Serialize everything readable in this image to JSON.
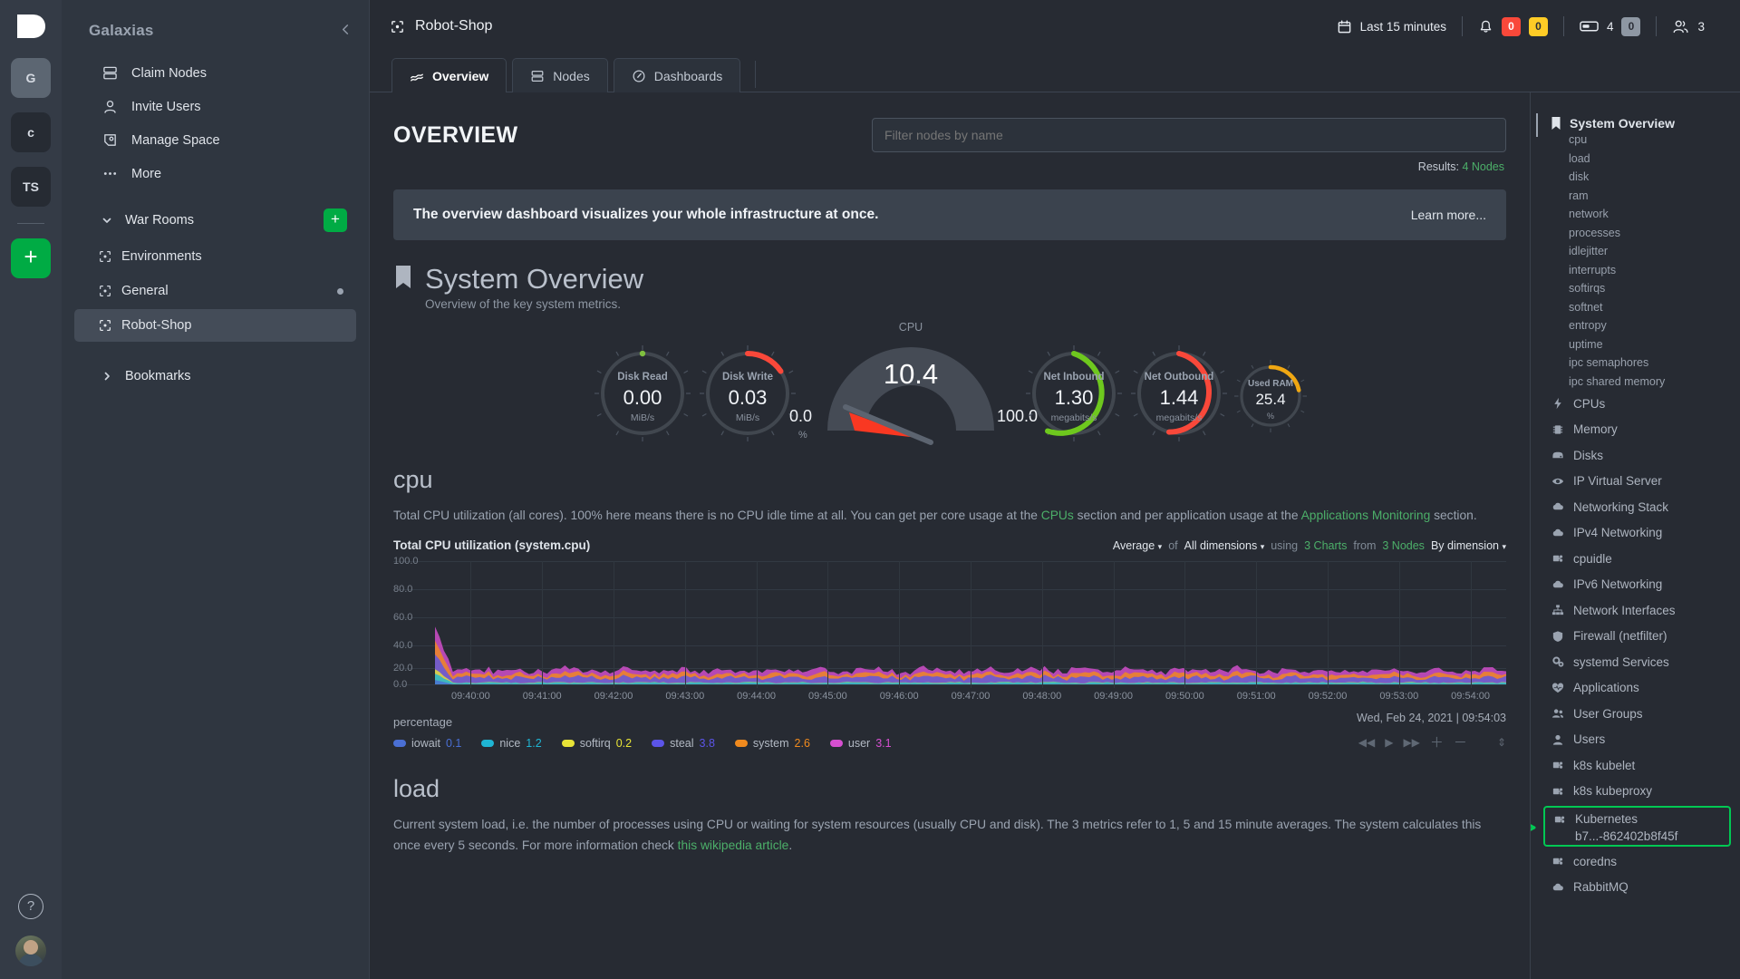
{
  "rail": {
    "logo_name": "netdata-logo",
    "spaces": [
      {
        "initials": "G",
        "active": true
      },
      {
        "initials": "c",
        "active": false
      },
      {
        "initials": "TS",
        "active": false
      }
    ],
    "add_space_label": "+",
    "help_label": "?"
  },
  "sidebar": {
    "space_title": "Galaxias",
    "collapse_icon": "chevron-left-icon",
    "items": [
      {
        "label": "Claim Nodes",
        "icon": "server-icon"
      },
      {
        "label": "Invite Users",
        "icon": "user-icon"
      },
      {
        "label": "Manage Space",
        "icon": "space-icon"
      },
      {
        "label": "More",
        "icon": "ellipsis-icon"
      }
    ],
    "war_rooms": {
      "label": "War Rooms",
      "add_label": "+",
      "rooms": [
        {
          "label": "Environments",
          "selected": false,
          "unread": false
        },
        {
          "label": "General",
          "selected": false,
          "unread": true
        },
        {
          "label": "Robot-Shop",
          "selected": true,
          "unread": false
        }
      ]
    },
    "bookmarks": {
      "label": "Bookmarks"
    }
  },
  "topbar": {
    "room_title": "Robot-Shop",
    "time_range": "Last 15 minutes",
    "alarms": {
      "critical": "0",
      "warning": "0"
    },
    "nodes": {
      "online": "4",
      "offline": "0"
    },
    "users": "3"
  },
  "tabs": [
    {
      "label": "Overview",
      "icon": "overview-icon",
      "active": true
    },
    {
      "label": "Nodes",
      "icon": "nodes-icon",
      "active": false
    },
    {
      "label": "Dashboards",
      "icon": "gauge-icon",
      "active": false
    }
  ],
  "overview": {
    "title": "OVERVIEW",
    "filter_placeholder": "Filter nodes by name",
    "filter_value": "",
    "results_label": "Results:",
    "results_value": "4 Nodes",
    "banner_text": "The overview dashboard visualizes your whole infrastructure at once.",
    "banner_link": "Learn more...",
    "section_title": "System Overview",
    "section_subtitle": "Overview of the key system metrics."
  },
  "gauges": [
    {
      "label": "Disk Read",
      "value": "0.00",
      "unit": "MiB/s",
      "pct": 0,
      "color": "#7fbf3f",
      "size": "large"
    },
    {
      "label": "Disk Write",
      "value": "0.03",
      "unit": "MiB/s",
      "pct": 14,
      "color": "#f9483a",
      "size": "large"
    },
    {
      "label": "Net Inbound",
      "value": "1.30",
      "unit": "megabits/s",
      "pct": 72,
      "color": "#6ec81e",
      "size": "large"
    },
    {
      "label": "Net Outbound",
      "value": "1.44",
      "unit": "megabits/s",
      "pct": 66,
      "color": "#f9483a",
      "size": "large"
    },
    {
      "label": "Used RAM",
      "value": "25.4",
      "unit": "%",
      "pct": 26,
      "color": "#efa712",
      "size": "small"
    }
  ],
  "cpu_gauge": {
    "label": "CPU",
    "value": "10.4",
    "min": "0.0",
    "min_unit": "%",
    "max": "100.0",
    "needle_pct": 10.4,
    "needle_color": "#f93822"
  },
  "sections": [
    {
      "id": "cpu",
      "title": "cpu",
      "desc_parts": [
        {
          "t": "Total CPU utilization (all cores). 100% here means there is no CPU idle time at all. You can get per core usage at the ",
          "link": false
        },
        {
          "t": "CPUs",
          "link": true
        },
        {
          "t": " section and per application usage at the ",
          "link": false
        },
        {
          "t": "Applications Monitoring",
          "link": true
        },
        {
          "t": " section.",
          "link": false
        }
      ]
    },
    {
      "id": "load",
      "title": "load",
      "desc_parts": [
        {
          "t": "Current system load, i.e. the number of processes using CPU or waiting for system resources (usually CPU and disk). The 3 metrics refer to 1, 5 and 15 minute averages. The system calculates this once every 5 seconds. For more information check ",
          "link": false
        },
        {
          "t": "this wikipedia article",
          "link": true
        },
        {
          "t": ".",
          "link": false
        }
      ]
    }
  ],
  "chart": {
    "name": "Total CPU utilization (system.cpu)",
    "controls": {
      "aggregate": "Average",
      "of_label": "of",
      "dimensions": "All dimensions",
      "using_label": "using",
      "charts_count": "3 Charts",
      "from_label": "from",
      "nodes_count": "3 Nodes",
      "group_by": "By dimension"
    },
    "timestamp": "Wed, Feb 24, 2021 | 09:54:03",
    "playback": [
      "rewind-icon",
      "play-icon",
      "fast-forward-icon",
      "zoom-in-icon",
      "zoom-out-icon",
      "resize-icon"
    ],
    "unit_label": "percentage"
  },
  "chart_data": {
    "type": "area",
    "title": "Total CPU utilization (system.cpu)",
    "xlabel": "",
    "ylabel": "percentage",
    "ylim": [
      0,
      100
    ],
    "grid": true,
    "legend": "bottom",
    "ytick_labels": [
      "100.0",
      "80.0",
      "60.0",
      "40.0",
      "20.0",
      "0.0"
    ],
    "ytick_values": [
      100,
      80,
      60,
      40,
      20,
      0
    ],
    "xtick_labels": [
      "09:40:00",
      "09:41:00",
      "09:42:00",
      "09:43:00",
      "09:44:00",
      "09:45:00",
      "09:46:00",
      "09:47:00",
      "09:48:00",
      "09:49:00",
      "09:50:00",
      "09:51:00",
      "09:52:00",
      "09:53:00",
      "09:54:00"
    ],
    "stacked": true,
    "series": [
      {
        "name": "iowait",
        "value": "0.1",
        "color": "#4a6fd4",
        "avg": 0.1
      },
      {
        "name": "nice",
        "value": "1.2",
        "color": "#1fb5d4",
        "avg": 1.2
      },
      {
        "name": "softirq",
        "value": "0.2",
        "color": "#e8e337",
        "avg": 0.2
      },
      {
        "name": "steal",
        "value": "3.8",
        "color": "#5b54e8",
        "avg": 3.8
      },
      {
        "name": "system",
        "value": "2.6",
        "color": "#f08a1e",
        "avg": 2.6
      },
      {
        "name": "user",
        "value": "3.1",
        "color": "#d64fd0",
        "avg": 3.1
      }
    ]
  },
  "rightbar": {
    "head": {
      "label": "System Overview",
      "icon": "bookmark-icon"
    },
    "sub_items": [
      "cpu",
      "load",
      "disk",
      "ram",
      "network",
      "processes",
      "idlejitter",
      "interrupts",
      "softirqs",
      "softnet",
      "entropy",
      "uptime",
      "ipc semaphores",
      "ipc shared memory"
    ],
    "items": [
      {
        "label": "CPUs",
        "icon": "bolt-icon"
      },
      {
        "label": "Memory",
        "icon": "memory-icon"
      },
      {
        "label": "Disks",
        "icon": "disk-icon"
      },
      {
        "label": "IP Virtual Server",
        "icon": "eye-icon"
      },
      {
        "label": "Networking Stack",
        "icon": "cloud-icon"
      },
      {
        "label": "IPv4 Networking",
        "icon": "cloud-icon"
      },
      {
        "label": "cpuidle",
        "icon": "puzzle-icon"
      },
      {
        "label": "IPv6 Networking",
        "icon": "cloud-icon"
      },
      {
        "label": "Network Interfaces",
        "icon": "network-icon"
      },
      {
        "label": "Firewall (netfilter)",
        "icon": "shield-icon"
      },
      {
        "label": "systemd Services",
        "icon": "gears-icon"
      },
      {
        "label": "Applications",
        "icon": "apps-icon"
      },
      {
        "label": "User Groups",
        "icon": "users-icon"
      },
      {
        "label": "Users",
        "icon": "user-icon"
      },
      {
        "label": "k8s kubelet",
        "icon": "puzzle-icon"
      },
      {
        "label": "k8s kubeproxy",
        "icon": "puzzle-icon"
      }
    ],
    "highlighted": {
      "label_line1": "Kubernetes",
      "label_line2": "b7...-862402b8f45f",
      "icon": "puzzle-icon",
      "border_color": "#00c853",
      "annotation": "green-arrow"
    },
    "items_after": [
      {
        "label": "coredns",
        "icon": "puzzle-icon"
      },
      {
        "label": "RabbitMQ",
        "icon": "cloud-icon"
      }
    ]
  }
}
